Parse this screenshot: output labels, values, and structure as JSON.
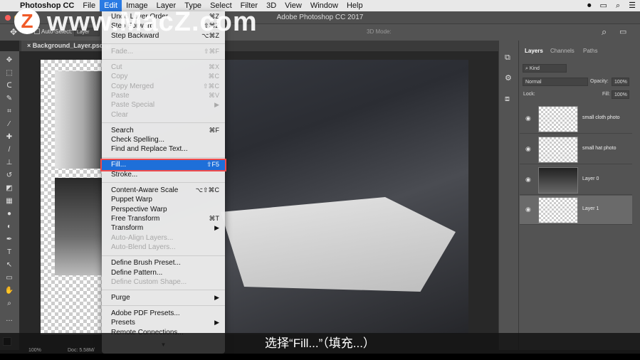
{
  "menubar": {
    "app": "Photoshop CC",
    "items": [
      "File",
      "Edit",
      "Image",
      "Layer",
      "Type",
      "Select",
      "Filter",
      "3D",
      "View",
      "Window",
      "Help"
    ]
  },
  "window_title": "Adobe Photoshop CC 2017",
  "options": {
    "auto_select": "Auto-Select:",
    "layer": "Layer",
    "mode_3d": "3D Mode:"
  },
  "tab": "Background_Layer.psd @",
  "layers_panel": {
    "tabs": [
      "Layers",
      "Channels",
      "Paths"
    ],
    "filter": "Kind",
    "blend": "Normal",
    "opacity_label": "Opacity:",
    "opacity": "100%",
    "lock_label": "Lock:",
    "fill_label": "Fill:",
    "fill": "100%",
    "layers": [
      {
        "name": "small cloth photo"
      },
      {
        "name": "small hat photo"
      },
      {
        "name": "Layer 0"
      },
      {
        "name": "Layer 1",
        "selected": true
      }
    ]
  },
  "edit_menu": {
    "groups": [
      [
        {
          "label": "Undo Layer Order",
          "sc": "⌘Z"
        },
        {
          "label": "Step Forward",
          "sc": "⇧⌘Z"
        },
        {
          "label": "Step Backward",
          "sc": "⌥⌘Z"
        }
      ],
      [
        {
          "label": "Fade...",
          "sc": "⇧⌘F",
          "disabled": true
        }
      ],
      [
        {
          "label": "Cut",
          "sc": "⌘X",
          "disabled": true
        },
        {
          "label": "Copy",
          "sc": "⌘C",
          "disabled": true
        },
        {
          "label": "Copy Merged",
          "sc": "⇧⌘C",
          "disabled": true
        },
        {
          "label": "Paste",
          "sc": "⌘V",
          "disabled": true
        },
        {
          "label": "Paste Special",
          "sc": "▶",
          "disabled": true
        },
        {
          "label": "Clear",
          "sc": "",
          "disabled": true
        }
      ],
      [
        {
          "label": "Search",
          "sc": "⌘F"
        },
        {
          "label": "Check Spelling...",
          "sc": ""
        },
        {
          "label": "Find and Replace Text...",
          "sc": ""
        }
      ],
      [
        {
          "label": "Fill...",
          "sc": "⇧F5",
          "highlighted": true
        },
        {
          "label": "Stroke...",
          "sc": ""
        }
      ],
      [
        {
          "label": "Content-Aware Scale",
          "sc": "⌥⇧⌘C"
        },
        {
          "label": "Puppet Warp",
          "sc": ""
        },
        {
          "label": "Perspective Warp",
          "sc": ""
        },
        {
          "label": "Free Transform",
          "sc": "⌘T"
        },
        {
          "label": "Transform",
          "sc": "▶"
        },
        {
          "label": "Auto-Align Layers...",
          "sc": "",
          "disabled": true
        },
        {
          "label": "Auto-Blend Layers...",
          "sc": "",
          "disabled": true
        }
      ],
      [
        {
          "label": "Define Brush Preset...",
          "sc": ""
        },
        {
          "label": "Define Pattern...",
          "sc": ""
        },
        {
          "label": "Define Custom Shape...",
          "sc": "",
          "disabled": true
        }
      ],
      [
        {
          "label": "Purge",
          "sc": "▶"
        }
      ],
      [
        {
          "label": "Adobe PDF Presets...",
          "sc": ""
        },
        {
          "label": "Presets",
          "sc": "▶"
        },
        {
          "label": "Remote Connections...",
          "sc": ""
        }
      ]
    ]
  },
  "status": {
    "zoom": "100%",
    "doc": "Doc: 5.58M/"
  },
  "subtitle": "选择“Fill...”（填充...）",
  "watermark": "www.MacZ.com",
  "watermark_logo": "Z",
  "colors": {
    "accent": "#1e6fd9",
    "highlight_outline": "#f04b4b"
  }
}
